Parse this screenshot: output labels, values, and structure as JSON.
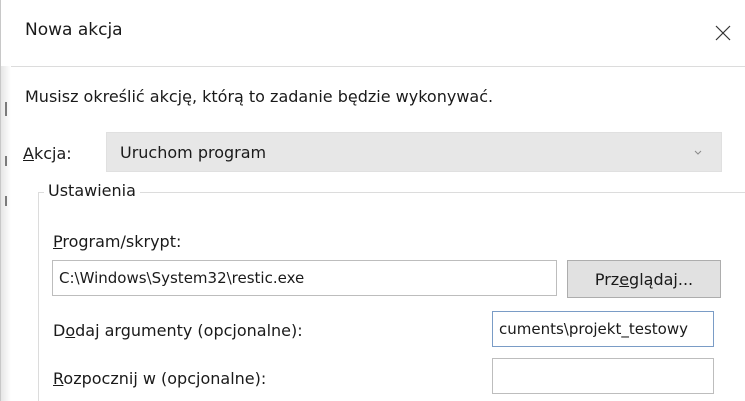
{
  "dialog": {
    "title": "Nowa akcja",
    "instruction": "Musisz określić akcję, którą to zadanie będzie wykonywać."
  },
  "action": {
    "label_accel": "A",
    "label_rest": "kcja:",
    "selected": "Uruchom program"
  },
  "settings": {
    "group_label": "Ustawienia",
    "program": {
      "label_accel": "P",
      "label_rest": "rogram/skrypt:",
      "value": "C:\\Windows\\System32\\restic.exe"
    },
    "browse": {
      "label_before": "Prz",
      "label_accel": "e",
      "label_after": "glądaj..."
    },
    "arguments": {
      "label_before": "D",
      "label_accel": "o",
      "label_after": "daj argumenty (opcjonalne):",
      "value": "cuments\\projekt_testowy"
    },
    "start_in": {
      "label_accel": "R",
      "label_rest": "ozpocznij w (opcjonalne):",
      "value": ""
    }
  },
  "icons": {
    "close": "close-icon",
    "dropdown": "chevron-down-icon"
  },
  "colors": {
    "combo_bg": "#e7e7e7",
    "button_bg": "#e1e1e1",
    "focus_border": "#7a9cc6"
  }
}
